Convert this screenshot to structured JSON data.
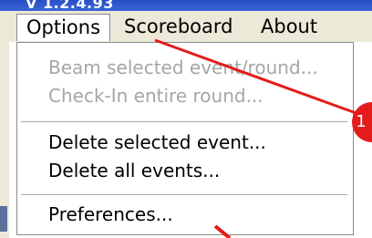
{
  "window": {
    "title_fragment": "V 1.2.4.93"
  },
  "menubar": {
    "items": [
      {
        "label": "Options",
        "active": true
      },
      {
        "label": "Scoreboard",
        "active": false
      },
      {
        "label": "About",
        "active": false
      }
    ]
  },
  "dropdown": {
    "items": [
      {
        "label": "Beam selected event/round...",
        "enabled": false
      },
      {
        "label": "Check-In entire round...",
        "enabled": false
      },
      {
        "label": "Delete selected event...",
        "enabled": true
      },
      {
        "label": "Delete all events...",
        "enabled": true
      },
      {
        "label": "Preferences...",
        "enabled": true
      }
    ]
  },
  "annotation": {
    "badge_number": "1",
    "color": "#e31b1b"
  }
}
